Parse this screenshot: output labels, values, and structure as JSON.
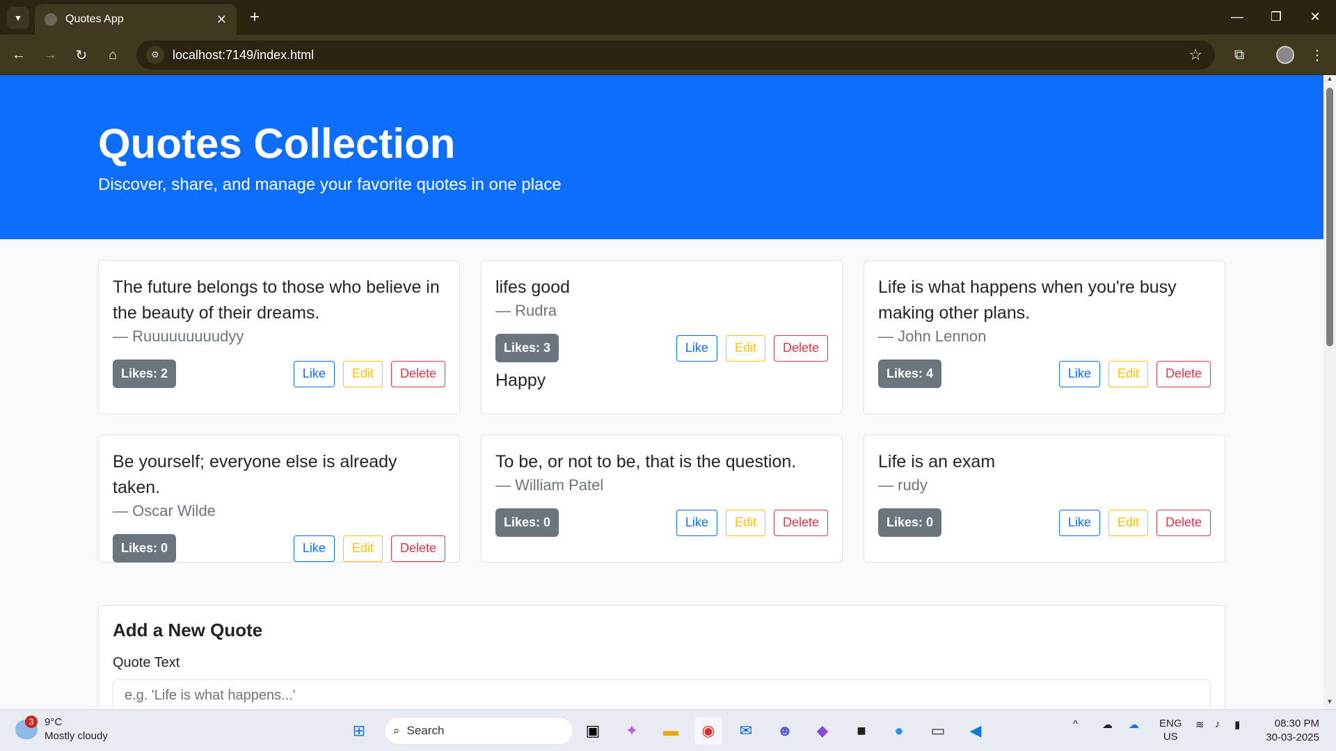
{
  "browser": {
    "tab_title": "Quotes App",
    "url": "localhost:7149/index.html"
  },
  "hero": {
    "title": "Quotes Collection",
    "subtitle": "Discover, share, and manage your favorite quotes in one place"
  },
  "actions": {
    "like": "Like",
    "edit": "Edit",
    "delete": "Delete"
  },
  "quotes": [
    {
      "text": "The future belongs to those who believe in the beauty of their dreams.",
      "author": "— Ruuuuuuuuudyy",
      "likes": "Likes: 2",
      "tag": ""
    },
    {
      "text": "lifes good",
      "author": "— Rudra",
      "likes": "Likes: 3",
      "tag": "Happy"
    },
    {
      "text": "Life is what happens when you're busy making other plans.",
      "author": "— John Lennon",
      "likes": "Likes: 4",
      "tag": ""
    },
    {
      "text": "Be yourself; everyone else is already taken.",
      "author": "— Oscar Wilde",
      "likes": "Likes: 0",
      "tag": ""
    },
    {
      "text": "To be, or not to be, that is the question.",
      "author": "— William Patel",
      "likes": "Likes: 0",
      "tag": ""
    },
    {
      "text": "Life is an exam",
      "author": "— rudy",
      "likes": "Likes: 0",
      "tag": ""
    }
  ],
  "form": {
    "heading": "Add a New Quote",
    "quote_label": "Quote Text",
    "quote_placeholder": "e.g. 'Life is what happens...'",
    "quote_value": ""
  },
  "taskbar": {
    "weather_badge": "3",
    "temperature": "9°C",
    "condition": "Mostly cloudy",
    "search_label": "Search",
    "lang_top": "ENG",
    "lang_bottom": "US",
    "time": "08:30 PM",
    "date": "30-03-2025"
  },
  "colors": {
    "primary": "#0d6efd",
    "warning": "#ffc107",
    "danger": "#dc3545",
    "secondary": "#6c757d",
    "chrome_dark": "#2b2410",
    "chrome_bar": "#40391f"
  }
}
